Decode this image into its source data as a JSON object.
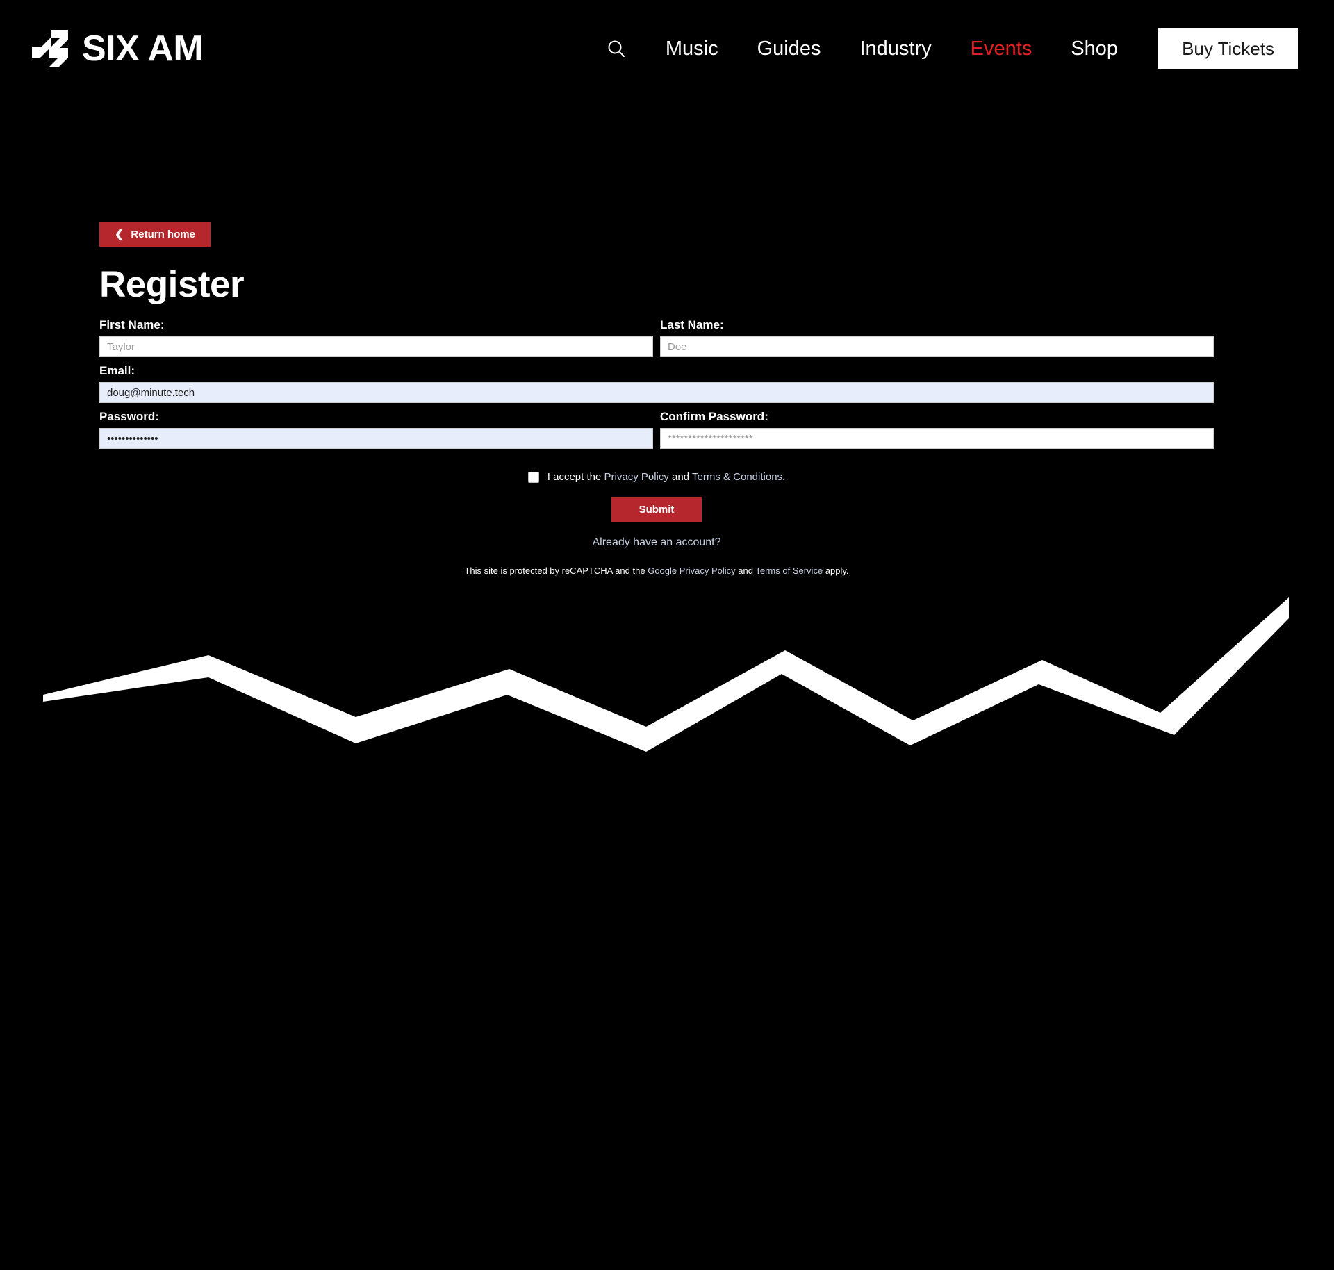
{
  "header": {
    "brand_name": "SIX AM",
    "brand_logo_icon": "sixam-s-logo-icon",
    "search_icon": "search-icon",
    "nav_items": [
      {
        "label": "Music",
        "active": false
      },
      {
        "label": "Guides",
        "active": false
      },
      {
        "label": "Industry",
        "active": false
      },
      {
        "label": "Events",
        "active": true
      },
      {
        "label": "Shop",
        "active": false
      }
    ],
    "buy_tickets_label": "Buy Tickets",
    "active_color": "#e02020"
  },
  "page": {
    "return_home_label": "Return home",
    "return_home_icon": "chevron-left-icon",
    "title": "Register"
  },
  "form": {
    "first_name": {
      "label": "First Name:",
      "placeholder": "Taylor",
      "value": ""
    },
    "last_name": {
      "label": "Last Name:",
      "placeholder": "Doe",
      "value": ""
    },
    "email": {
      "label": "Email:",
      "placeholder": "doug@minute.tech",
      "value": "doug@minute.tech",
      "autofilled": true
    },
    "password": {
      "label": "Password:",
      "placeholder": "",
      "value": "••••••••••••••",
      "autofilled": true
    },
    "confirm_password": {
      "label": "Confirm Password:",
      "placeholder": "*********************",
      "value": ""
    },
    "consent": {
      "checked": false,
      "text_before": "I accept the",
      "privacy_policy_label": "Privacy Policy",
      "text_middle": "and",
      "terms_label": "Terms & Conditions",
      "text_after": "."
    },
    "submit_label": "Submit",
    "already_have_account_label": "Already have an account?",
    "recaptcha": {
      "text_before": "This site is protected by reCAPTCHA and the",
      "google_privacy_label": "Google Privacy Policy",
      "text_middle": "and",
      "google_terms_label": "Terms of Service",
      "text_after": "apply."
    }
  },
  "theme": {
    "background": "#000000",
    "accent_red": "#b5272d",
    "nav_active_red": "#e02020",
    "autofill_blue": "#e8edfb",
    "link_color": "#c8d2e4"
  },
  "decoration": {
    "zigzag_icon": "lightning-zigzag-graphic",
    "zigzag_color": "#ffffff"
  }
}
